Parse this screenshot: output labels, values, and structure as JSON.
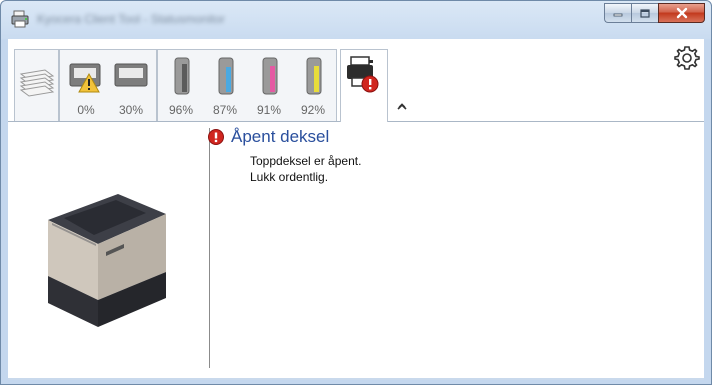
{
  "window": {
    "title": "Kyocera Client Tool - Statusmonitor",
    "colors": {
      "titlebar": "#c9dbf0",
      "accent": "#2a4f9d",
      "error": "#d0261f"
    }
  },
  "caption_buttons": {
    "minimize_icon": "minimize-icon",
    "maximize_icon": "maximize-icon",
    "close_icon": "close-icon"
  },
  "toolbar": {
    "tabs": [
      {
        "icon": "paper-stack-icon"
      },
      {
        "icon": "paper-tray-warning-icon",
        "level": "0%"
      },
      {
        "icon": "paper-tray-icon",
        "level": "30%"
      },
      {
        "icon": "toner-black-icon",
        "level": "96%",
        "color": "#6e6e6e"
      },
      {
        "icon": "toner-cyan-icon",
        "level": "87%",
        "color": "#4aa9e2"
      },
      {
        "icon": "toner-magenta-icon",
        "level": "91%",
        "color": "#e45aa3"
      },
      {
        "icon": "toner-yellow-icon",
        "level": "92%",
        "color": "#e8dc3a"
      },
      {
        "icon": "printer-error-icon",
        "active": true
      }
    ],
    "expander_icon": "chevron-up-icon",
    "settings_icon": "gear-icon"
  },
  "status": {
    "title": "Åpent deksel",
    "lines": [
      "Toppdeksel er åpent.",
      "Lukk ordentlig."
    ]
  }
}
